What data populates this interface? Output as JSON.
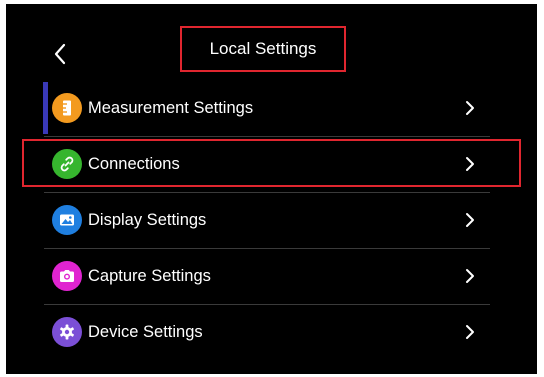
{
  "header": {
    "title": "Local Settings",
    "back_icon": "chevron-left-icon"
  },
  "menu": {
    "items": [
      {
        "label": "Measurement Settings",
        "icon": "ruler-icon",
        "icon_color": "#f39a1f",
        "selected": true
      },
      {
        "label": "Connections",
        "icon": "link-icon",
        "icon_color": "#36b52e",
        "selected": false
      },
      {
        "label": "Display Settings",
        "icon": "image-icon",
        "icon_color": "#1f7fe0",
        "selected": false
      },
      {
        "label": "Capture Settings",
        "icon": "camera-icon",
        "icon_color": "#e024d0",
        "selected": false
      },
      {
        "label": "Device Settings",
        "icon": "gear-icon",
        "icon_color": "#7b4fd6",
        "selected": false
      }
    ],
    "chevron_icon": "chevron-right-icon"
  },
  "colors": {
    "background": "#000000",
    "text": "#ffffff",
    "highlight_border": "#e0262f",
    "selection_accent": "#3a39b8",
    "divider": "#3a3a3a"
  }
}
